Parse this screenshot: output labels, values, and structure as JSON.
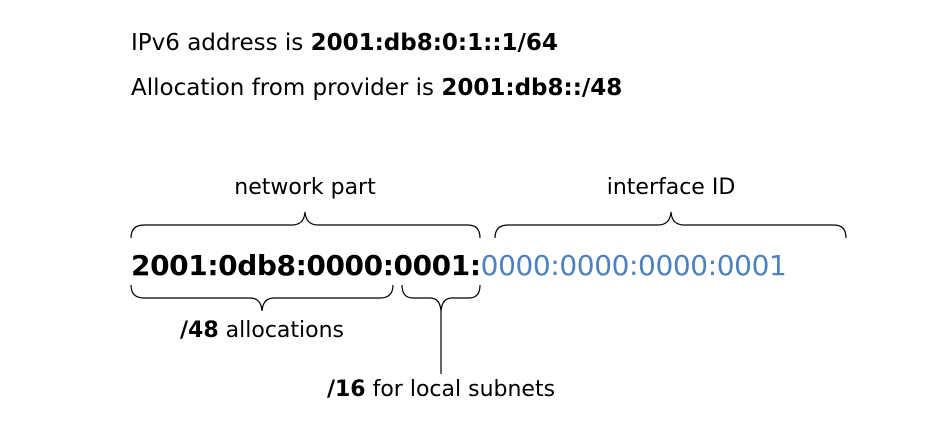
{
  "intro": {
    "line1_prefix": "IPv6 address is ",
    "line1_value": "2001:db8:0:1::1/64",
    "line2_prefix": "Allocation from provider is ",
    "line2_value": "2001:db8::/48"
  },
  "address": {
    "allocation_part": "2001:0db8:0000:",
    "subnet_part": "0001",
    "separator": ":",
    "interface_part": "0000:0000:0000:0001"
  },
  "labels": {
    "network_part": "network part",
    "interface_id": "interface ID",
    "allocations_prefix": "/48",
    "allocations_suffix": " allocations",
    "subnets_prefix": "/16",
    "subnets_suffix": " for local subnets"
  },
  "colors": {
    "interface_id": "#4f81bd",
    "text": "#000000"
  }
}
